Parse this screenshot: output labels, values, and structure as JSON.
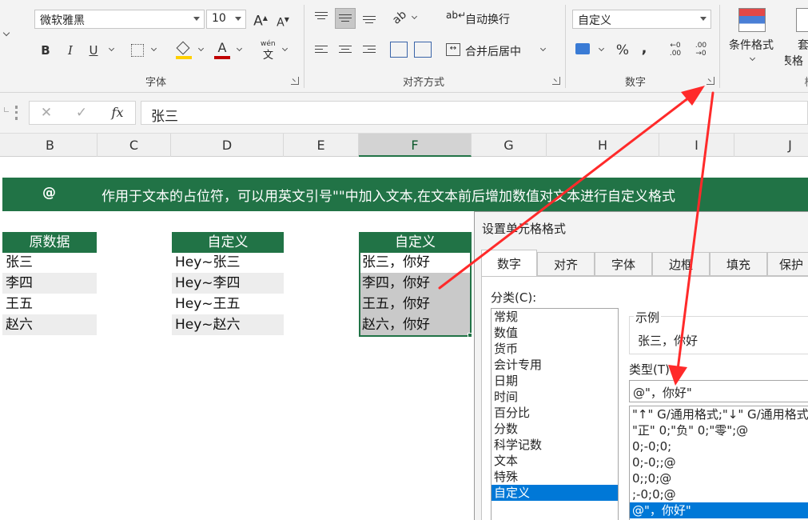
{
  "ribbon": {
    "font": {
      "font_name": "微软雅黑",
      "font_size": "10",
      "grow_font": "A",
      "shrink_font": "A",
      "bold": "B",
      "italic": "I",
      "underline": "U",
      "font_color_letter": "A",
      "highlight_color": "#ffd000",
      "font_color": "#c00000",
      "phonetic": "wén",
      "group_label": "字体"
    },
    "alignment": {
      "wrap_text": "自动换行",
      "merge_center": "合并后居中",
      "group_label": "对齐方式"
    },
    "number": {
      "format": "自定义",
      "percent": "%",
      "comma": ",",
      "inc_decimal": "←0 .00",
      "dec_decimal": ".00 →0",
      "group_label": "数字"
    },
    "styles": {
      "conditional_formatting": "条件格式",
      "format_as_table_1": "套",
      "format_as_table_2": "表格",
      "group_label_partial": "样"
    }
  },
  "formula_bar": {
    "cancel": "✕",
    "enter": "✓",
    "fx": "fx",
    "value": "张三"
  },
  "columns": [
    "B",
    "C",
    "D",
    "E",
    "F",
    "G",
    "H",
    "I",
    "J"
  ],
  "selected_column": "F",
  "sheet": {
    "banner_symbol": "@",
    "banner_text": "作用于文本的占位符，可以用英文引号\"\"中加入文本,在文本前后增加数值对文本进行自定义格式",
    "table1": {
      "header": "原数据",
      "rows": [
        "张三",
        "李四",
        "王五",
        "赵六"
      ]
    },
    "table2": {
      "header": "自定义",
      "rows": [
        "Hey~张三",
        "Hey~李四",
        "Hey~王五",
        "Hey~赵六"
      ]
    },
    "table3": {
      "header": "自定义",
      "rows": [
        "张三，你好",
        "李四，你好",
        "王五，你好",
        "赵六，你好"
      ]
    }
  },
  "dialog": {
    "title": "设置单元格格式",
    "tabs": [
      "数字",
      "对齐",
      "字体",
      "边框",
      "填充",
      "保护"
    ],
    "active_tab": "数字",
    "category_label": "分类(C):",
    "categories": [
      "常规",
      "数值",
      "货币",
      "会计专用",
      "日期",
      "时间",
      "百分比",
      "分数",
      "科学记数",
      "文本",
      "特殊",
      "自定义"
    ],
    "selected_category": "自定义",
    "sample_label": "示例",
    "sample_value": "张三，你好",
    "type_label": "类型(T):",
    "type_value": "@\"，你好\"",
    "type_list": [
      "\"↑\" G/通用格式;\"↓\" G/通用格式;-",
      "\"正\" 0;\"负\" 0;\"零\";@",
      "0;-0;0;",
      "0;-0;;@",
      "0;;0;@",
      ";-0;0;@",
      "@\"，你好\""
    ],
    "selected_type": "@\"，你好\""
  },
  "colors": {
    "excel_green": "#217346",
    "arrow_red": "#ff2a2a",
    "selection_blue": "#0078d7"
  }
}
